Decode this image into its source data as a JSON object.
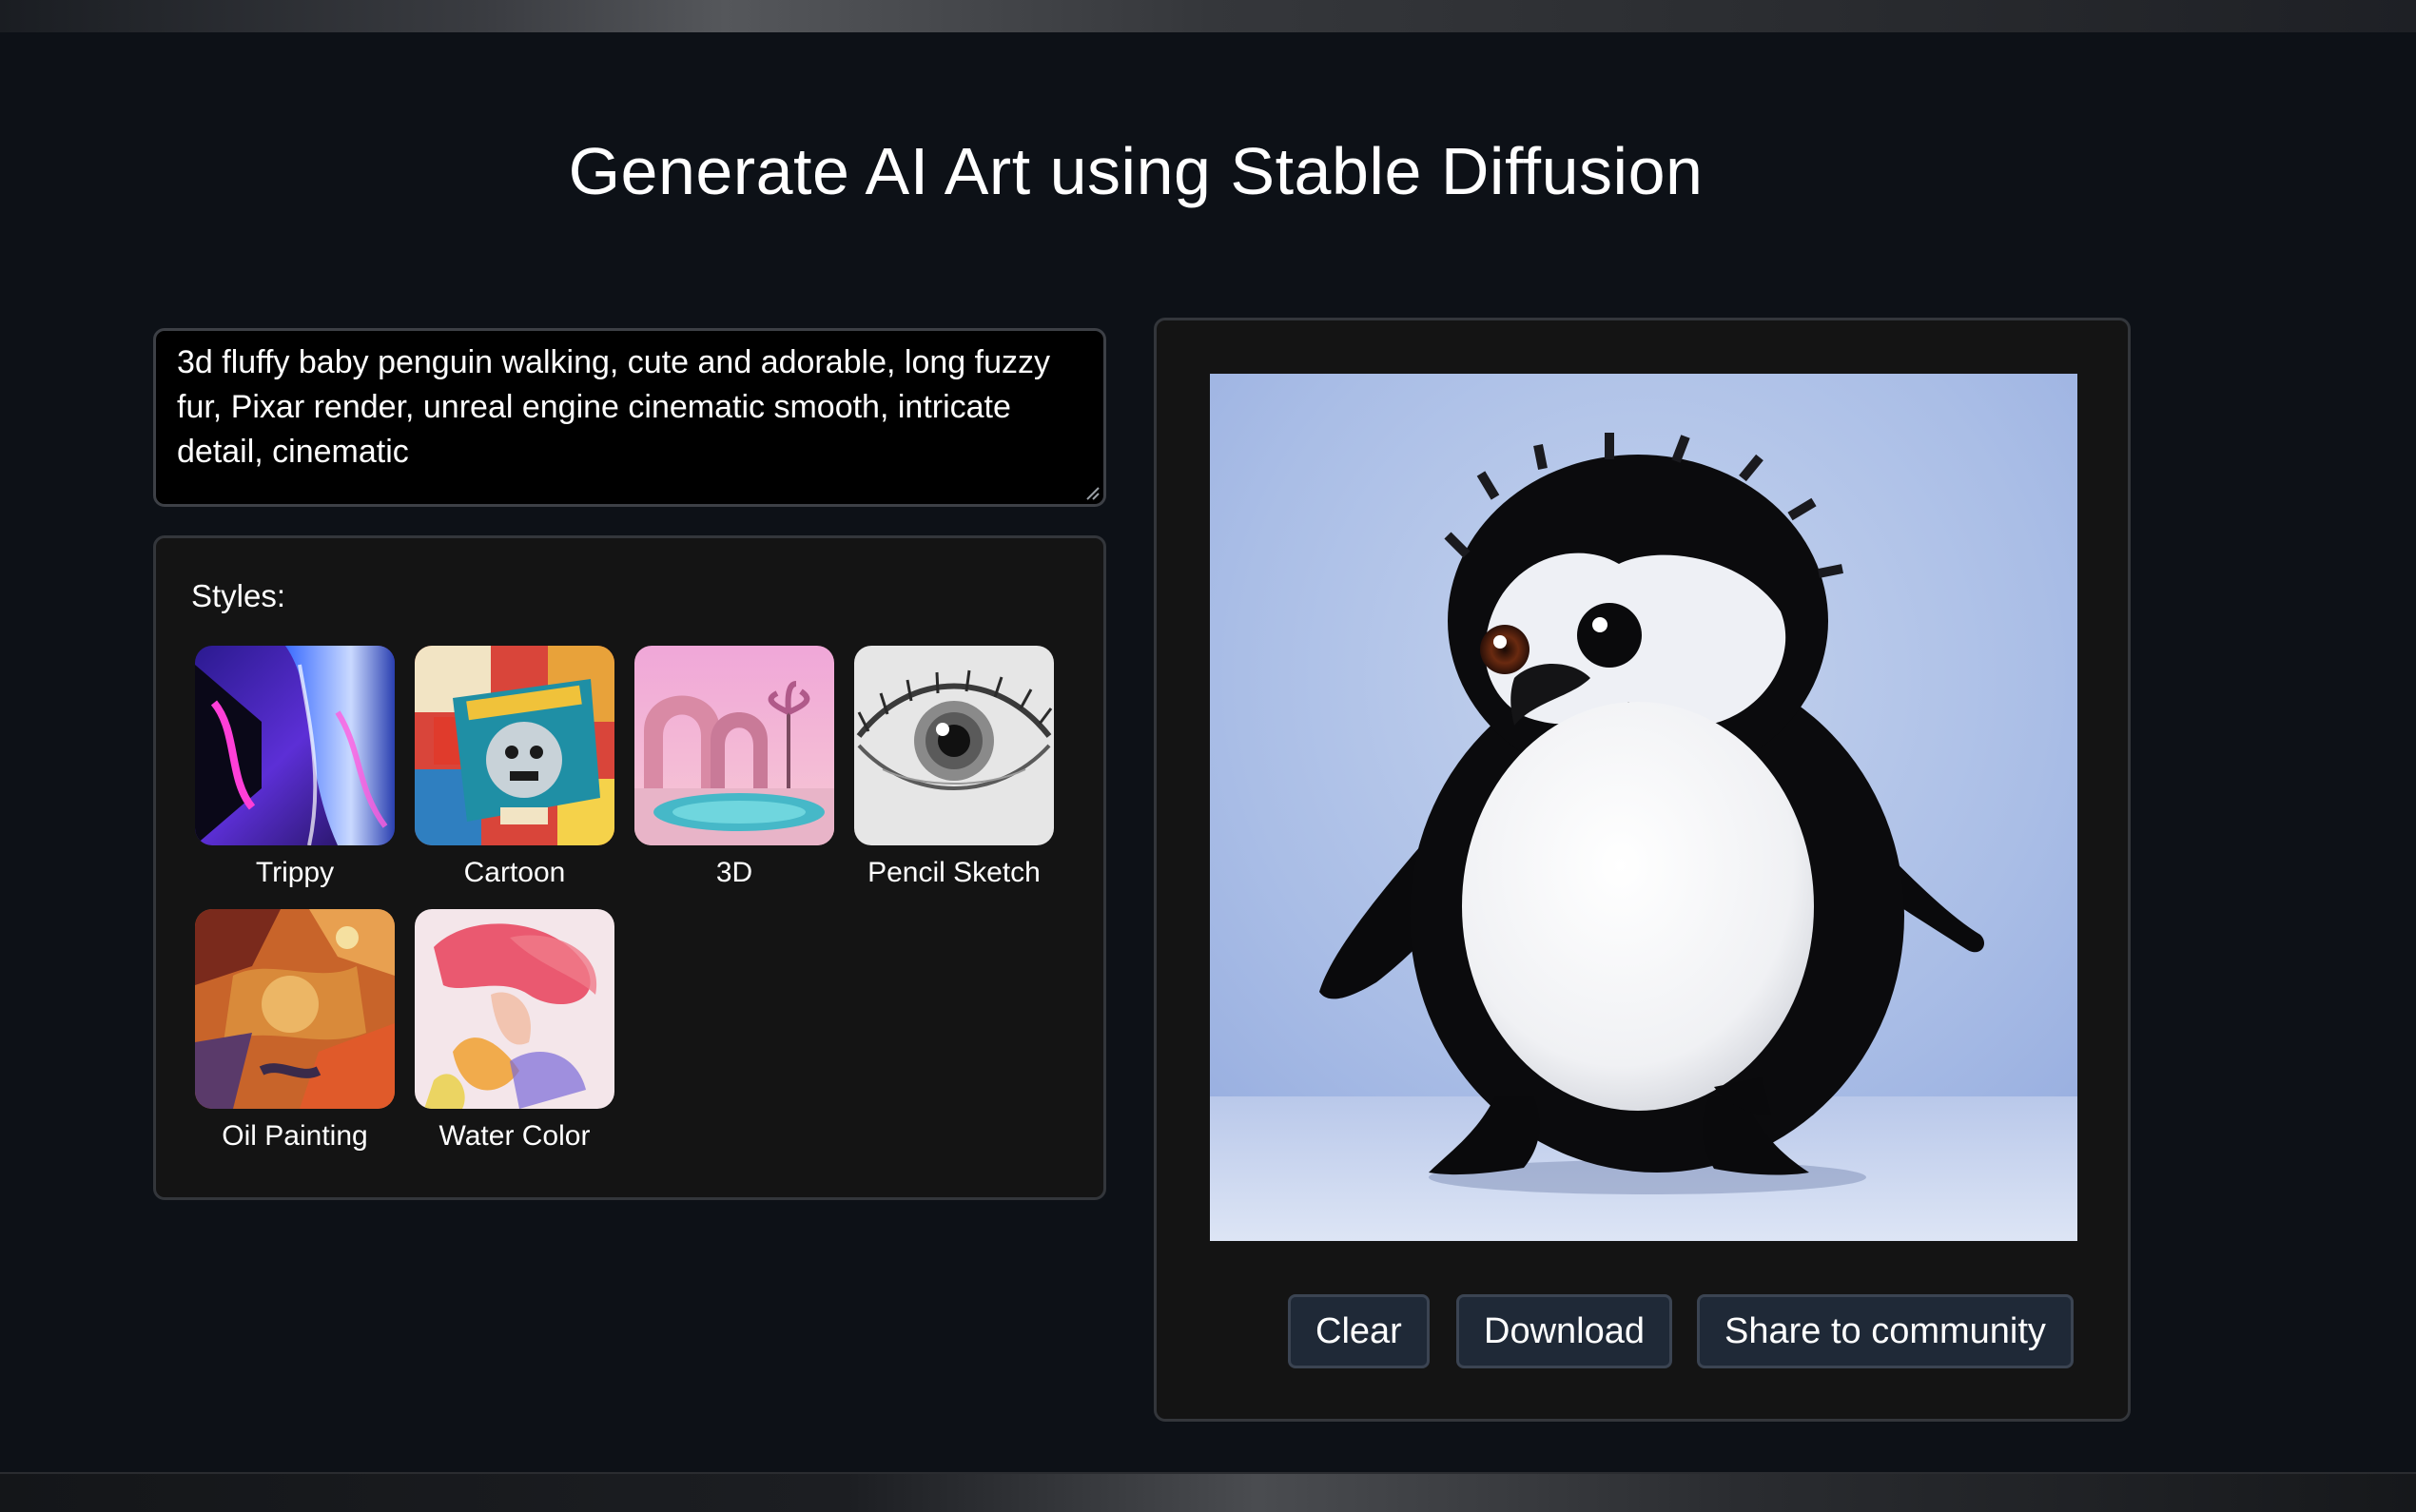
{
  "page": {
    "title": "Generate AI Art using Stable Diffusion"
  },
  "prompt": {
    "value": "3d fluffy baby penguin walking, cute and adorable, long fuzzy fur, Pixar render, unreal engine cinematic smooth, intricate detail, cinematic"
  },
  "styles": {
    "label": "Styles:",
    "items": [
      {
        "label": "Trippy"
      },
      {
        "label": "Cartoon"
      },
      {
        "label": "3D"
      },
      {
        "label": "Pencil Sketch"
      },
      {
        "label": "Oil Painting"
      },
      {
        "label": "Water Color"
      }
    ]
  },
  "actions": {
    "clear": "Clear",
    "download": "Download",
    "share": "Share to community"
  },
  "colors": {
    "background": "#0d1117",
    "panel": "#141414",
    "panel_border": "#33363b",
    "button": "#1f2937",
    "button_border": "#3b4452",
    "text": "#ffffff"
  }
}
